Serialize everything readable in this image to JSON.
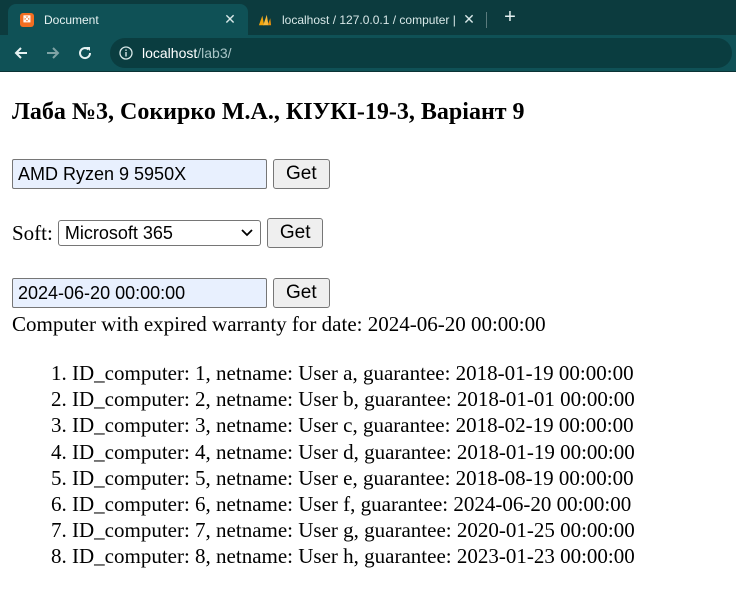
{
  "browser": {
    "tabs": [
      {
        "title": "Document",
        "icon": "xampp-icon",
        "active": true
      },
      {
        "title": "localhost / 127.0.0.1 / computer |",
        "icon": "phpmyadmin-icon",
        "active": false
      }
    ],
    "url_host": "localhost",
    "url_path": "/lab3/",
    "theme_colors": {
      "tabbar": "#0c3b3e",
      "toolbar": "#0f5156"
    }
  },
  "page": {
    "heading": "Лаба №3, Сокирко М.А., КІУКІ-19-3, Варіант 9",
    "processor_form": {
      "value": "AMD Ryzen 9 5950X",
      "button": "Get"
    },
    "soft_form": {
      "label": "Soft:",
      "selected": "Microsoft 365",
      "button": "Get"
    },
    "date_form": {
      "value": "2024-06-20 00:00:00",
      "button": "Get"
    },
    "result_title": "Computer with expired warranty for date: 2024-06-20 00:00:00",
    "results": [
      "ID_computer: 1, netname: User a, guarantee: 2018-01-19 00:00:00",
      "ID_computer: 2, netname: User b, guarantee: 2018-01-01 00:00:00",
      "ID_computer: 3, netname: User c, guarantee: 2018-02-19 00:00:00",
      "ID_computer: 4, netname: User d, guarantee: 2018-01-19 00:00:00",
      "ID_computer: 5, netname: User e, guarantee: 2018-08-19 00:00:00",
      "ID_computer: 6, netname: User f, guarantee: 2024-06-20 00:00:00",
      "ID_computer: 7, netname: User g, guarantee: 2020-01-25 00:00:00",
      "ID_computer: 8, netname: User h, guarantee: 2023-01-23 00:00:00"
    ]
  }
}
